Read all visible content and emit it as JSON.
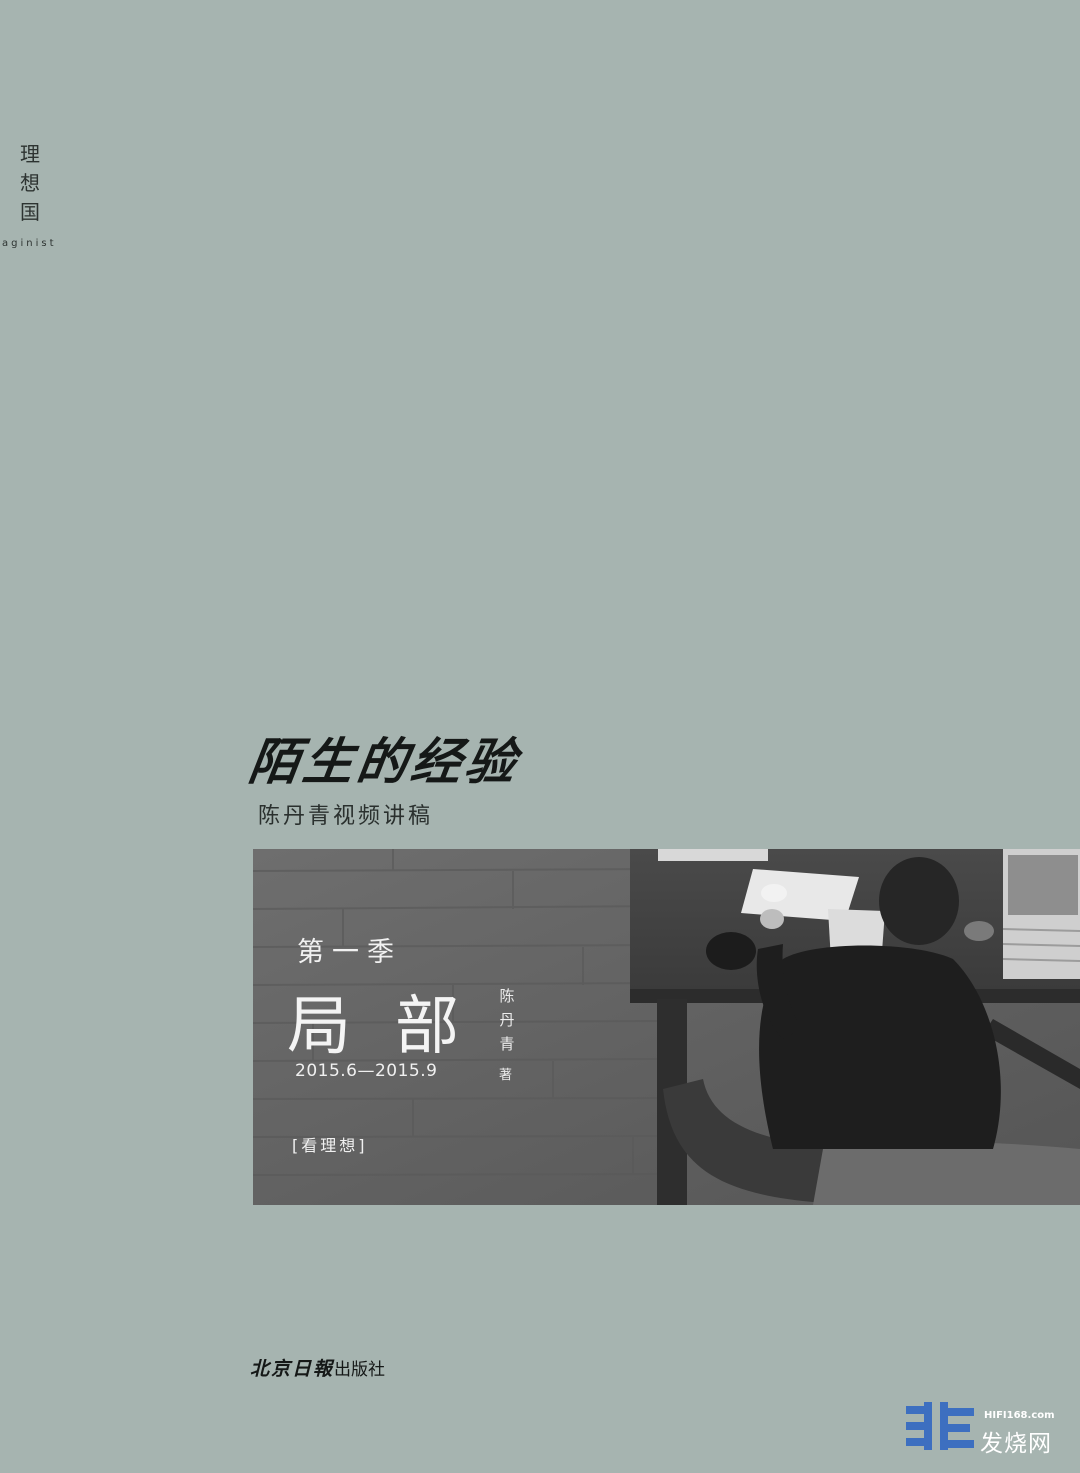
{
  "imprint": {
    "chars": [
      "理",
      "想",
      "国"
    ],
    "latin": "aginist"
  },
  "cover": {
    "calligraphy_title": "陌生的经验",
    "subtitle": "陈丹青视频讲稿",
    "season": "第一季",
    "title": "局部",
    "author_chars": [
      "陈",
      "丹",
      "青"
    ],
    "author_role": "著",
    "date_range": "2015.6—2015.9",
    "series_tag": "[看理想]",
    "publisher_brand": "北京日報",
    "publisher_suffix": "出版社"
  },
  "watermark": {
    "url": "HIFI168.com",
    "name": "发烧网"
  },
  "colors": {
    "background": "#a6b4b0",
    "ink": "#151817",
    "photo_tone": "#5b5b5b",
    "watermark_logo": "#3d6fc0"
  }
}
